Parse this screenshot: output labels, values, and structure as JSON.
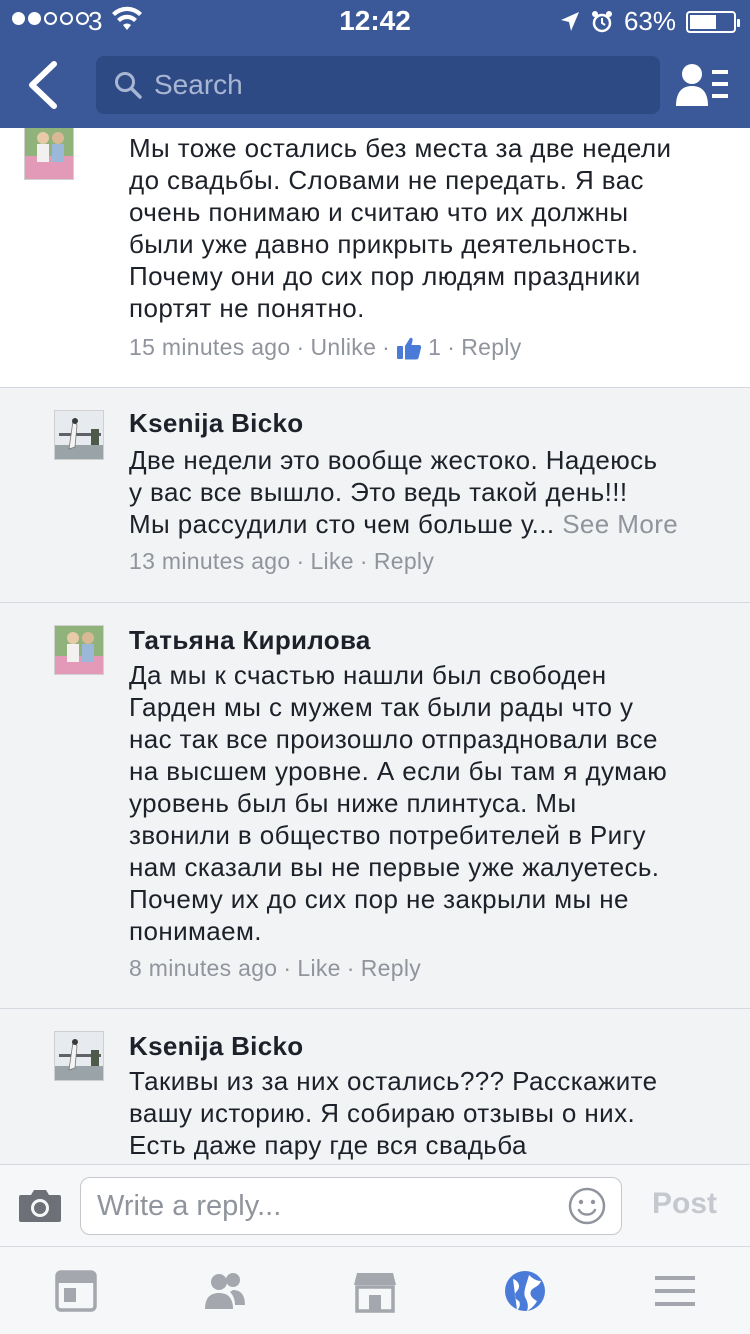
{
  "status_bar": {
    "carrier": "3",
    "time": "12:42",
    "battery_percent": "63%",
    "battery_level": 0.63,
    "signal_bars_filled": 2,
    "signal_bars_total": 5
  },
  "nav": {
    "search_placeholder": "Search"
  },
  "comments": [
    {
      "author": "",
      "text": "Мы тоже остались без места за  две недели\nдо свадьбы. Словами не передать. Я вас\nочень понимаю и считаю что их должны\nбыли уже давно прикрыть деятельность.\nПочему они до сих пор людям праздники\nпортят не понятно.",
      "time": "15 minutes ago",
      "like_label": "Unlike",
      "like_count": "1",
      "reply_label": "Reply"
    },
    {
      "author": "Ksenija Bicko",
      "text": "Две недели это вообще жестоко. Надеюсь\nу вас все вышло. Это ведь такой день!!!\nМы рассудили сто чем больше у... ",
      "see_more": "See More",
      "time": "13 minutes ago",
      "like_label": "Like",
      "reply_label": "Reply"
    },
    {
      "author": "Татьяна Кирилова",
      "text": "Да мы к счастью нашли был свободен\nГарден мы с мужем так были рады что у\nнас так все произошло отпраздновали все\nна высшем уровне. А  если бы там я думаю\nуровень был бы ниже плинтуса. Мы\nзвонили в общество потребителей в Ригу\nнам сказали вы не первые уже жалуетесь.\nПочему их до сих пор не закрыли мы не\nпонимаем.",
      "time": "8 minutes ago",
      "like_label": "Like",
      "reply_label": "Reply"
    },
    {
      "author": "Ksenija Bicko",
      "text": "Такивы из за них остались??? Расскажите\nвашу историю. Я собираю отзывы о них.\nЕсть даже пару где вся свадьба"
    }
  ],
  "reply_bar": {
    "placeholder": "Write a reply...",
    "post_label": "Post"
  },
  "tab_bar": {
    "tabs": [
      "news-feed",
      "friends",
      "marketplace",
      "notifications",
      "more"
    ],
    "active": "notifications"
  },
  "colors": {
    "brand": "#3b5998",
    "meta_gray": "#90949c",
    "text": "#1d2129",
    "active_tab": "#4a7bd8"
  }
}
